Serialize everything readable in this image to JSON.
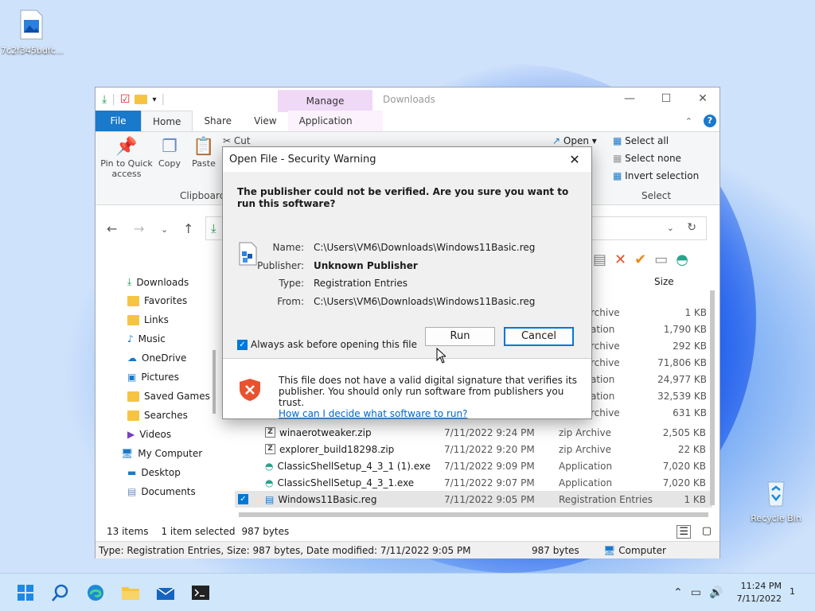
{
  "desktop": {
    "file_icon_label": "7c2f345bdfc...",
    "recycle_label": "Recycle Bin"
  },
  "explorer": {
    "title": "Downloads",
    "manage_tab": "Manage",
    "tabs": [
      "File",
      "Home",
      "Share",
      "View",
      "Application Tools"
    ],
    "ribbon": {
      "pin": "Pin to Quick access",
      "copy": "Copy",
      "paste": "Paste",
      "cut": "Cut",
      "clipboard": "Clipboard",
      "open": "Open",
      "select_all": "Select all",
      "select_none": "Select none",
      "invert_selection": "Invert selection",
      "select_group": "Select"
    },
    "size_header": "Size",
    "nav_items": [
      "Downloads",
      "Favorites",
      "Links",
      "Music",
      "OneDrive",
      "Pictures",
      "Saved Games",
      "Searches",
      "Videos",
      "My Computer",
      "Desktop",
      "Documents"
    ],
    "right_sizes": [
      {
        "type": "rchive",
        "size": "1 KB"
      },
      {
        "type": "ation",
        "size": "1,790 KB"
      },
      {
        "type": "rchive",
        "size": "292 KB"
      },
      {
        "type": "rchive",
        "size": "71,806 KB"
      },
      {
        "type": "ation",
        "size": "24,977 KB"
      },
      {
        "type": "ation",
        "size": "32,539 KB"
      },
      {
        "type": "rchive",
        "size": "631 KB"
      }
    ],
    "files": [
      {
        "name": "winaerotweaker.zip",
        "date": "7/11/2022 9:24 PM",
        "type": "zip Archive",
        "size": "2,505 KB"
      },
      {
        "name": "explorer_build18298.zip",
        "date": "7/11/2022 9:20 PM",
        "type": "zip Archive",
        "size": "22 KB"
      },
      {
        "name": "ClassicShellSetup_4_3_1 (1).exe",
        "date": "7/11/2022 9:09 PM",
        "type": "Application",
        "size": "7,020 KB"
      },
      {
        "name": "ClassicShellSetup_4_3_1.exe",
        "date": "7/11/2022 9:07 PM",
        "type": "Application",
        "size": "7,020 KB"
      },
      {
        "name": "Windows11Basic.reg",
        "date": "7/11/2022 9:05 PM",
        "type": "Registration Entries",
        "size": "1 KB"
      }
    ],
    "status": {
      "items": "13 items",
      "selected": "1 item selected",
      "bytes": "987 bytes",
      "details": "Type: Registration Entries, Size: 987 bytes, Date modified: 7/11/2022 9:05 PM",
      "bytes2": "987 bytes",
      "computer": "Computer"
    }
  },
  "dialog": {
    "title": "Open File - Security Warning",
    "question": "The publisher could not be verified.  Are you sure you want to run this software?",
    "fields": {
      "name_label": "Name:",
      "name_value": "C:\\Users\\VM6\\Downloads\\Windows11Basic.reg",
      "publisher_label": "Publisher:",
      "publisher_value": "Unknown Publisher",
      "type_label": "Type:",
      "type_value": "Registration Entries",
      "from_label": "From:",
      "from_value": "C:\\Users\\VM6\\Downloads\\Windows11Basic.reg"
    },
    "run_label": "Run",
    "cancel_label": "Cancel",
    "always_ask": "Always ask before opening this file",
    "footer_text": "This file does not have a valid digital signature that verifies its publisher.  You should only run software from publishers you trust.",
    "footer_link": "How can I decide what software to run?"
  },
  "taskbar": {
    "time": "11:24 PM",
    "date": "7/11/2022",
    "notifications": "1"
  },
  "colors": {
    "accent": "#0078d7",
    "file_tab": "#1979ca",
    "manage_tab": "#f0d9f7",
    "shield": "#e8532f"
  }
}
